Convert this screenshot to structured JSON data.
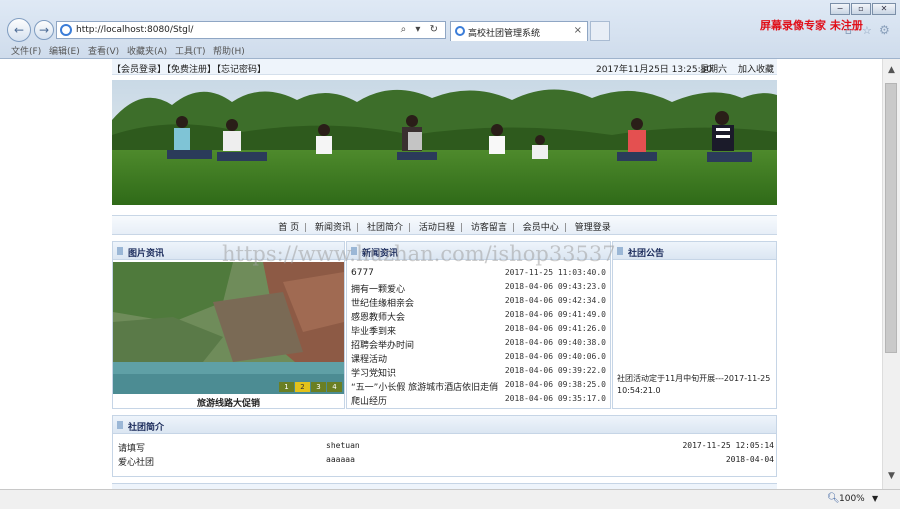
{
  "browser": {
    "url": "http://localhost:8080/Stgl/",
    "tab_title": "高校社团管理系统",
    "tab_close": "×",
    "address_tools": "⌕ ▾ ↻",
    "recorder_watermark": "屏幕录像专家  未注册",
    "menu": [
      "文件(F)",
      "编辑(E)",
      "查看(V)",
      "收藏夹(A)",
      "工具(T)",
      "帮助(H)"
    ],
    "zoom": "100%",
    "window_controls": [
      "−",
      "▫",
      "✕"
    ]
  },
  "site": {
    "top_links": [
      "【会员登录】",
      "【免费注册】",
      "【忘记密码】"
    ],
    "datetime": "2017年11月25日  13:25:30",
    "weekday": "星期六",
    "bookmark": "加入收藏",
    "nav": [
      "首 页",
      "新闻资讯",
      "社团简介",
      "活动日程",
      "访客留言",
      "会员中心",
      "管理登录"
    ],
    "watermark": "https://www.huzhan.com/ishop33537",
    "pictures": {
      "title": "图片资讯",
      "caption": "旅游线路大促销",
      "pager": [
        "1",
        "2",
        "3",
        "4"
      ],
      "active_page": 2
    },
    "news": {
      "title": "新闻资讯",
      "items": [
        {
          "title": "6777",
          "date": "2017-11-25 11:03:40.0"
        },
        {
          "title": "拥有一颗爱心",
          "date": "2018-04-06 09:43:23.0"
        },
        {
          "title": "世纪佳缘相亲会",
          "date": "2018-04-06 09:42:34.0"
        },
        {
          "title": "感恩教师大会",
          "date": "2018-04-06 09:41:49.0"
        },
        {
          "title": "毕业季到来",
          "date": "2018-04-06 09:41:26.0"
        },
        {
          "title": "招聘会举办时间",
          "date": "2018-04-06 09:40:38.0"
        },
        {
          "title": "课程活动",
          "date": "2018-04-06 09:40:06.0"
        },
        {
          "title": "学习党知识",
          "date": "2018-04-06 09:39:22.0"
        },
        {
          "title": "“五一”小长假 旅游城市酒店依旧走俏",
          "date": "2018-04-06 09:38:25.0"
        },
        {
          "title": "爬山经历",
          "date": "2018-04-06 09:35:17.0"
        }
      ]
    },
    "notice": {
      "title": "社团公告",
      "text": "社团活动定于11月中旬开展---2017-11-25 10:54:21.0"
    },
    "clubs": {
      "title": "社团简介",
      "items": [
        {
          "name": "请填写",
          "slug": "shetuan",
          "date": "2017-11-25 12:05:14"
        },
        {
          "name": "爱心社团",
          "slug": "aaaaaa",
          "date": "2018-04-04"
        }
      ]
    }
  }
}
